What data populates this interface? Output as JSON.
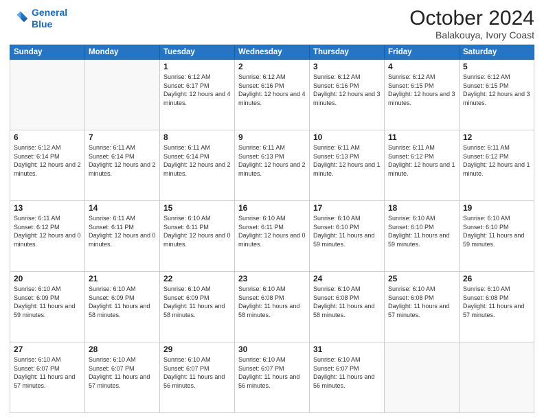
{
  "logo": {
    "line1": "General",
    "line2": "Blue"
  },
  "header": {
    "month": "October 2024",
    "location": "Balakouya, Ivory Coast"
  },
  "weekdays": [
    "Sunday",
    "Monday",
    "Tuesday",
    "Wednesday",
    "Thursday",
    "Friday",
    "Saturday"
  ],
  "weeks": [
    [
      {
        "day": "",
        "info": ""
      },
      {
        "day": "",
        "info": ""
      },
      {
        "day": "1",
        "info": "Sunrise: 6:12 AM\nSunset: 6:17 PM\nDaylight: 12 hours and 4 minutes."
      },
      {
        "day": "2",
        "info": "Sunrise: 6:12 AM\nSunset: 6:16 PM\nDaylight: 12 hours and 4 minutes."
      },
      {
        "day": "3",
        "info": "Sunrise: 6:12 AM\nSunset: 6:16 PM\nDaylight: 12 hours and 3 minutes."
      },
      {
        "day": "4",
        "info": "Sunrise: 6:12 AM\nSunset: 6:15 PM\nDaylight: 12 hours and 3 minutes."
      },
      {
        "day": "5",
        "info": "Sunrise: 6:12 AM\nSunset: 6:15 PM\nDaylight: 12 hours and 3 minutes."
      }
    ],
    [
      {
        "day": "6",
        "info": "Sunrise: 6:12 AM\nSunset: 6:14 PM\nDaylight: 12 hours and 2 minutes."
      },
      {
        "day": "7",
        "info": "Sunrise: 6:11 AM\nSunset: 6:14 PM\nDaylight: 12 hours and 2 minutes."
      },
      {
        "day": "8",
        "info": "Sunrise: 6:11 AM\nSunset: 6:14 PM\nDaylight: 12 hours and 2 minutes."
      },
      {
        "day": "9",
        "info": "Sunrise: 6:11 AM\nSunset: 6:13 PM\nDaylight: 12 hours and 2 minutes."
      },
      {
        "day": "10",
        "info": "Sunrise: 6:11 AM\nSunset: 6:13 PM\nDaylight: 12 hours and 1 minute."
      },
      {
        "day": "11",
        "info": "Sunrise: 6:11 AM\nSunset: 6:12 PM\nDaylight: 12 hours and 1 minute."
      },
      {
        "day": "12",
        "info": "Sunrise: 6:11 AM\nSunset: 6:12 PM\nDaylight: 12 hours and 1 minute."
      }
    ],
    [
      {
        "day": "13",
        "info": "Sunrise: 6:11 AM\nSunset: 6:12 PM\nDaylight: 12 hours and 0 minutes."
      },
      {
        "day": "14",
        "info": "Sunrise: 6:11 AM\nSunset: 6:11 PM\nDaylight: 12 hours and 0 minutes."
      },
      {
        "day": "15",
        "info": "Sunrise: 6:10 AM\nSunset: 6:11 PM\nDaylight: 12 hours and 0 minutes."
      },
      {
        "day": "16",
        "info": "Sunrise: 6:10 AM\nSunset: 6:11 PM\nDaylight: 12 hours and 0 minutes."
      },
      {
        "day": "17",
        "info": "Sunrise: 6:10 AM\nSunset: 6:10 PM\nDaylight: 11 hours and 59 minutes."
      },
      {
        "day": "18",
        "info": "Sunrise: 6:10 AM\nSunset: 6:10 PM\nDaylight: 11 hours and 59 minutes."
      },
      {
        "day": "19",
        "info": "Sunrise: 6:10 AM\nSunset: 6:10 PM\nDaylight: 11 hours and 59 minutes."
      }
    ],
    [
      {
        "day": "20",
        "info": "Sunrise: 6:10 AM\nSunset: 6:09 PM\nDaylight: 11 hours and 59 minutes."
      },
      {
        "day": "21",
        "info": "Sunrise: 6:10 AM\nSunset: 6:09 PM\nDaylight: 11 hours and 58 minutes."
      },
      {
        "day": "22",
        "info": "Sunrise: 6:10 AM\nSunset: 6:09 PM\nDaylight: 11 hours and 58 minutes."
      },
      {
        "day": "23",
        "info": "Sunrise: 6:10 AM\nSunset: 6:08 PM\nDaylight: 11 hours and 58 minutes."
      },
      {
        "day": "24",
        "info": "Sunrise: 6:10 AM\nSunset: 6:08 PM\nDaylight: 11 hours and 58 minutes."
      },
      {
        "day": "25",
        "info": "Sunrise: 6:10 AM\nSunset: 6:08 PM\nDaylight: 11 hours and 57 minutes."
      },
      {
        "day": "26",
        "info": "Sunrise: 6:10 AM\nSunset: 6:08 PM\nDaylight: 11 hours and 57 minutes."
      }
    ],
    [
      {
        "day": "27",
        "info": "Sunrise: 6:10 AM\nSunset: 6:07 PM\nDaylight: 11 hours and 57 minutes."
      },
      {
        "day": "28",
        "info": "Sunrise: 6:10 AM\nSunset: 6:07 PM\nDaylight: 11 hours and 57 minutes."
      },
      {
        "day": "29",
        "info": "Sunrise: 6:10 AM\nSunset: 6:07 PM\nDaylight: 11 hours and 56 minutes."
      },
      {
        "day": "30",
        "info": "Sunrise: 6:10 AM\nSunset: 6:07 PM\nDaylight: 11 hours and 56 minutes."
      },
      {
        "day": "31",
        "info": "Sunrise: 6:10 AM\nSunset: 6:07 PM\nDaylight: 11 hours and 56 minutes."
      },
      {
        "day": "",
        "info": ""
      },
      {
        "day": "",
        "info": ""
      }
    ]
  ]
}
